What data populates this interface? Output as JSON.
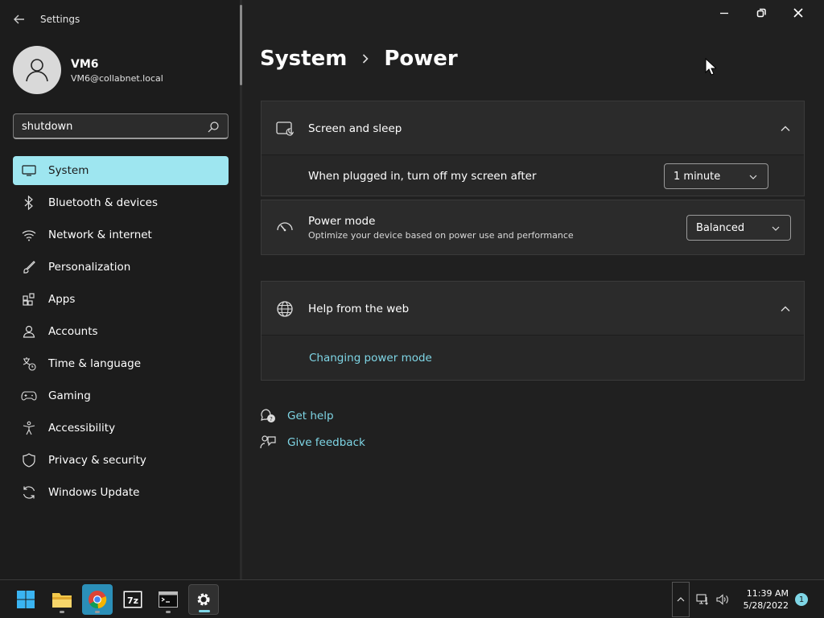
{
  "app": {
    "title": "Settings"
  },
  "user": {
    "name": "VM6",
    "email": "VM6@collabnet.local"
  },
  "search": {
    "value": "shutdown"
  },
  "nav": [
    {
      "label": "System",
      "icon": "monitor-icon",
      "active": true
    },
    {
      "label": "Bluetooth & devices",
      "icon": "bluetooth-icon"
    },
    {
      "label": "Network & internet",
      "icon": "wifi-icon"
    },
    {
      "label": "Personalization",
      "icon": "brush-icon"
    },
    {
      "label": "Apps",
      "icon": "apps-icon"
    },
    {
      "label": "Accounts",
      "icon": "person-icon"
    },
    {
      "label": "Time & language",
      "icon": "globe-clock-icon"
    },
    {
      "label": "Gaming",
      "icon": "gamepad-icon"
    },
    {
      "label": "Accessibility",
      "icon": "accessibility-icon"
    },
    {
      "label": "Privacy & security",
      "icon": "shield-icon"
    },
    {
      "label": "Windows Update",
      "icon": "update-icon"
    }
  ],
  "breadcrumb": {
    "parent": "System",
    "current": "Power"
  },
  "screen_sleep": {
    "title": "Screen and sleep",
    "row_label": "When plugged in, turn off my screen after",
    "row_value": "1 minute"
  },
  "power_mode": {
    "title": "Power mode",
    "desc": "Optimize your device based on power use and performance",
    "value": "Balanced"
  },
  "help_web": {
    "title": "Help from the web",
    "link": "Changing power mode"
  },
  "help_links": {
    "get_help": "Get help",
    "feedback": "Give feedback"
  },
  "taskbar": {
    "time": "11:39 AM",
    "date": "5/28/2022",
    "notifications": "1",
    "apps": [
      "start-icon",
      "file-explorer-icon",
      "chrome-icon",
      "7zip-icon",
      "terminal-icon",
      "settings-icon"
    ]
  }
}
